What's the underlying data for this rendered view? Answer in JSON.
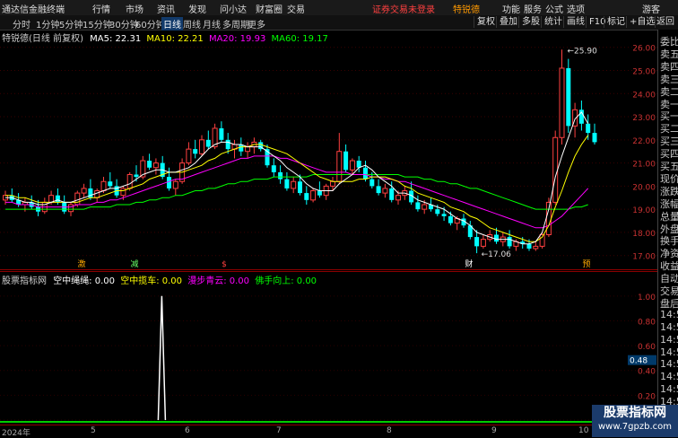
{
  "titlebar": {
    "app_name": "通达信金融终端",
    "menus": [
      "行情",
      "市场",
      "资讯",
      "发现",
      "问小达",
      "财富圈",
      "交易"
    ],
    "warning": "证券交易未登录",
    "account": "特锐德",
    "right_items": [
      "功能",
      "服务",
      "公式",
      "选项"
    ],
    "guest": "游客"
  },
  "periods": [
    "分时",
    "1分钟",
    "5分钟",
    "15分钟",
    "30分钟",
    "60分钟",
    "日线",
    "周线",
    "月线",
    "多周期",
    "更多"
  ],
  "active_period": "日线",
  "toolbar_right": [
    "复权",
    "叠加",
    "多股",
    "统计",
    "画线",
    "F10",
    "标记",
    "+自选",
    "返回"
  ],
  "ma": {
    "stock": "特锐德(日线 前复权)",
    "ma5": "MA5: 22.31",
    "ma10": "MA10: 22.21",
    "ma20": "MA20: 19.93",
    "ma60": "MA60: 19.17"
  },
  "colors": {
    "ma5": "#ffffff",
    "ma10": "#ffff00",
    "ma20": "#ff00ff",
    "ma60": "#00ff00",
    "up": "#ff4040",
    "down": "#00ffff"
  },
  "price_axis": [
    "26.00",
    "25.00",
    "24.00",
    "23.00",
    "22.00",
    "21.00",
    "20.00",
    "19.00",
    "18.00",
    "17.00"
  ],
  "annotations": {
    "high": "25.90",
    "low": "17.06"
  },
  "event_labels": [
    "激",
    "减",
    "$",
    "财",
    "预"
  ],
  "indicator": {
    "name": "股票指标网",
    "l1": "空中绳绳: 0.00",
    "l2": "空中揽车: 0.00",
    "l3": "漫步青云: 0.00",
    "l4": "佛手向上: 0.00",
    "axis": [
      "1.00",
      "0.80",
      "0.60",
      "0.40",
      "0.20",
      "0.00"
    ],
    "marker": "0.48"
  },
  "right_panel": [
    "委比",
    "卖五",
    "卖四",
    "卖三",
    "卖二",
    "卖一",
    "买一",
    "买二",
    "买三",
    "买四",
    "买五",
    "现价",
    "涨跌",
    "涨幅",
    "总量",
    "外盘",
    "换手",
    "净资",
    "收益",
    "自动",
    "交易",
    "盘后",
    "14:50",
    "14:50",
    "14:50",
    "14:50",
    "14:50",
    "14:50",
    "14:50",
    "14:50"
  ],
  "x_axis": [
    "2024年",
    "5",
    "6",
    "7",
    "8",
    "9",
    "10"
  ],
  "watermark": {
    "title": "股票指标网",
    "url": "www.7gpzb.com"
  },
  "chart_data": {
    "type": "candlestick",
    "ylim": [
      16.6,
      26.3
    ],
    "ohlc": [
      [
        19.4,
        19.8,
        19.2,
        19.6
      ],
      [
        19.6,
        19.9,
        19.3,
        19.4
      ],
      [
        19.4,
        19.7,
        19.1,
        19.2
      ],
      [
        19.2,
        19.5,
        18.9,
        19.3
      ],
      [
        19.3,
        19.6,
        19.0,
        19.1
      ],
      [
        19.1,
        19.4,
        18.7,
        18.9
      ],
      [
        18.9,
        19.5,
        18.8,
        19.3
      ],
      [
        19.3,
        19.8,
        19.2,
        19.6
      ],
      [
        19.6,
        19.9,
        19.2,
        19.3
      ],
      [
        19.3,
        19.6,
        18.8,
        18.9
      ],
      [
        18.9,
        19.3,
        18.7,
        19.2
      ],
      [
        19.2,
        19.8,
        19.1,
        19.7
      ],
      [
        19.7,
        20.1,
        19.5,
        19.9
      ],
      [
        19.9,
        20.3,
        19.4,
        19.5
      ],
      [
        19.5,
        19.9,
        19.3,
        19.8
      ],
      [
        19.8,
        20.4,
        19.7,
        20.2
      ],
      [
        20.2,
        20.6,
        19.9,
        20.0
      ],
      [
        20.0,
        20.3,
        19.5,
        19.6
      ],
      [
        19.6,
        20.0,
        19.4,
        19.9
      ],
      [
        19.9,
        20.6,
        19.8,
        20.5
      ],
      [
        20.5,
        20.9,
        20.2,
        20.4
      ],
      [
        20.4,
        21.3,
        20.3,
        21.1
      ],
      [
        21.1,
        21.4,
        20.7,
        20.8
      ],
      [
        20.8,
        21.2,
        20.5,
        21.0
      ],
      [
        21.0,
        21.3,
        20.3,
        20.4
      ],
      [
        20.4,
        20.8,
        19.8,
        19.9
      ],
      [
        19.9,
        20.3,
        19.6,
        20.2
      ],
      [
        20.2,
        21.2,
        20.1,
        21.0
      ],
      [
        21.0,
        21.9,
        20.9,
        21.6
      ],
      [
        21.6,
        22.0,
        21.2,
        21.4
      ],
      [
        21.4,
        22.2,
        21.3,
        22.0
      ],
      [
        22.0,
        22.4,
        21.6,
        21.7
      ],
      [
        21.7,
        22.7,
        21.6,
        22.5
      ],
      [
        22.5,
        22.8,
        21.9,
        22.0
      ],
      [
        22.0,
        22.3,
        21.4,
        21.6
      ],
      [
        21.6,
        22.0,
        21.2,
        21.8
      ],
      [
        21.8,
        22.1,
        21.3,
        21.5
      ],
      [
        21.5,
        21.9,
        21.2,
        21.7
      ],
      [
        21.7,
        22.1,
        21.4,
        21.9
      ],
      [
        21.9,
        22.0,
        21.5,
        21.6
      ],
      [
        21.6,
        21.8,
        20.8,
        20.9
      ],
      [
        20.9,
        21.2,
        20.4,
        20.6
      ],
      [
        20.6,
        20.9,
        20.1,
        20.3
      ],
      [
        20.3,
        20.6,
        19.8,
        19.9
      ],
      [
        19.9,
        20.4,
        19.7,
        20.2
      ],
      [
        20.2,
        20.5,
        19.6,
        19.7
      ],
      [
        19.7,
        20.0,
        19.2,
        19.4
      ],
      [
        19.4,
        19.9,
        19.3,
        19.8
      ],
      [
        19.8,
        20.2,
        19.5,
        19.6
      ],
      [
        19.6,
        20.1,
        19.4,
        20.0
      ],
      [
        20.0,
        20.4,
        19.8,
        20.2
      ],
      [
        20.2,
        22.3,
        20.1,
        21.5
      ],
      [
        21.5,
        21.8,
        20.6,
        20.7
      ],
      [
        20.7,
        21.2,
        20.5,
        21.1
      ],
      [
        21.1,
        21.3,
        20.6,
        20.8
      ],
      [
        20.8,
        21.1,
        20.2,
        20.3
      ],
      [
        20.3,
        20.6,
        19.9,
        20.0
      ],
      [
        20.0,
        20.3,
        19.6,
        19.7
      ],
      [
        19.7,
        20.1,
        19.5,
        19.9
      ],
      [
        19.9,
        20.2,
        19.3,
        19.4
      ],
      [
        19.4,
        19.8,
        19.2,
        19.6
      ],
      [
        19.6,
        20.0,
        19.4,
        19.8
      ],
      [
        19.8,
        20.2,
        19.2,
        19.3
      ],
      [
        19.3,
        19.6,
        18.9,
        19.0
      ],
      [
        19.0,
        19.4,
        18.8,
        19.2
      ],
      [
        19.2,
        19.5,
        18.9,
        19.0
      ],
      [
        19.0,
        19.2,
        18.7,
        18.8
      ],
      [
        18.8,
        19.1,
        18.5,
        18.7
      ],
      [
        18.7,
        18.9,
        18.3,
        18.4
      ],
      [
        18.4,
        18.7,
        18.1,
        18.6
      ],
      [
        18.6,
        18.8,
        18.2,
        18.3
      ],
      [
        18.3,
        18.5,
        17.7,
        17.8
      ],
      [
        17.8,
        18.1,
        17.1,
        17.4
      ],
      [
        17.4,
        17.9,
        17.3,
        17.7
      ],
      [
        17.7,
        18.1,
        17.6,
        17.9
      ],
      [
        17.9,
        18.2,
        17.5,
        17.6
      ],
      [
        17.6,
        18.0,
        17.4,
        17.8
      ],
      [
        17.8,
        18.1,
        17.3,
        17.4
      ],
      [
        17.4,
        17.7,
        17.2,
        17.6
      ],
      [
        17.6,
        17.8,
        17.3,
        17.5
      ],
      [
        17.5,
        17.7,
        17.2,
        17.3
      ],
      [
        17.3,
        17.6,
        17.2,
        17.4
      ],
      [
        17.4,
        18.0,
        17.3,
        17.9
      ],
      [
        17.9,
        19.5,
        17.8,
        19.3
      ],
      [
        19.3,
        22.4,
        19.2,
        22.1
      ],
      [
        22.1,
        25.9,
        21.8,
        25.1
      ],
      [
        25.1,
        25.5,
        22.3,
        22.6
      ],
      [
        22.6,
        23.6,
        22.1,
        23.3
      ],
      [
        23.3,
        23.7,
        22.4,
        22.7
      ],
      [
        22.7,
        23.1,
        22.0,
        22.3
      ],
      [
        22.3,
        22.7,
        21.8,
        21.9
      ]
    ],
    "ma5": [
      19.5,
      19.5,
      19.4,
      19.3,
      19.3,
      19.2,
      19.2,
      19.3,
      19.4,
      19.3,
      19.3,
      19.4,
      19.5,
      19.6,
      19.7,
      19.8,
      19.9,
      19.9,
      20.0,
      20.1,
      20.3,
      20.5,
      20.6,
      20.7,
      20.7,
      20.6,
      20.6,
      20.7,
      20.8,
      21.0,
      21.3,
      21.6,
      21.8,
      21.9,
      21.9,
      21.8,
      21.8,
      21.7,
      21.7,
      21.7,
      21.5,
      21.3,
      21.1,
      20.8,
      20.6,
      20.4,
      20.1,
      19.9,
      19.8,
      19.8,
      19.8,
      20.1,
      20.3,
      20.5,
      20.8,
      20.9,
      20.7,
      20.4,
      20.2,
      20.0,
      19.7,
      19.7,
      19.6,
      19.4,
      19.3,
      19.2,
      19.1,
      19.0,
      18.8,
      18.6,
      18.5,
      18.3,
      18.0,
      17.9,
      17.8,
      17.7,
      17.7,
      17.7,
      17.6,
      17.5,
      17.5,
      17.6,
      18.0,
      19.0,
      20.4,
      21.3,
      22.1,
      22.9,
      23.2,
      22.7
    ],
    "ma10": [
      19.6,
      19.6,
      19.5,
      19.5,
      19.4,
      19.3,
      19.3,
      19.3,
      19.3,
      19.3,
      19.3,
      19.3,
      19.4,
      19.5,
      19.5,
      19.6,
      19.7,
      19.8,
      19.8,
      19.9,
      20.0,
      20.1,
      20.3,
      20.4,
      20.5,
      20.6,
      20.6,
      20.6,
      20.7,
      20.8,
      20.9,
      21.1,
      21.2,
      21.4,
      21.5,
      21.6,
      21.7,
      21.7,
      21.8,
      21.8,
      21.7,
      21.6,
      21.5,
      21.4,
      21.2,
      21.0,
      20.8,
      20.6,
      20.4,
      20.3,
      20.2,
      20.2,
      20.2,
      20.2,
      20.3,
      20.3,
      20.4,
      20.4,
      20.4,
      20.3,
      20.2,
      20.0,
      19.9,
      19.7,
      19.6,
      19.5,
      19.4,
      19.3,
      19.1,
      19.0,
      18.9,
      18.7,
      18.6,
      18.4,
      18.2,
      18.1,
      18.0,
      17.9,
      17.8,
      17.7,
      17.6,
      17.6,
      17.8,
      18.3,
      19.1,
      19.8,
      20.6,
      21.3,
      21.8,
      22.2
    ],
    "ma20": [
      19.3,
      19.3,
      19.2,
      19.2,
      19.2,
      19.1,
      19.1,
      19.1,
      19.1,
      19.1,
      19.1,
      19.2,
      19.2,
      19.2,
      19.3,
      19.3,
      19.4,
      19.4,
      19.5,
      19.6,
      19.7,
      19.8,
      19.9,
      20.0,
      20.1,
      20.2,
      20.3,
      20.3,
      20.4,
      20.5,
      20.6,
      20.7,
      20.8,
      20.9,
      21.0,
      21.1,
      21.2,
      21.2,
      21.3,
      21.3,
      21.3,
      21.3,
      21.2,
      21.2,
      21.1,
      21.0,
      20.9,
      20.8,
      20.7,
      20.6,
      20.6,
      20.6,
      20.6,
      20.5,
      20.5,
      20.5,
      20.4,
      20.4,
      20.3,
      20.3,
      20.2,
      20.2,
      20.1,
      20.0,
      19.9,
      19.8,
      19.7,
      19.6,
      19.5,
      19.4,
      19.3,
      19.2,
      19.1,
      19.0,
      18.9,
      18.8,
      18.7,
      18.6,
      18.5,
      18.4,
      18.3,
      18.2,
      18.2,
      18.3,
      18.5,
      18.7,
      19.0,
      19.3,
      19.6,
      19.9
    ],
    "ma60": [
      19.0,
      19.0,
      19.0,
      19.0,
      19.0,
      19.0,
      19.0,
      19.0,
      19.0,
      19.0,
      19.0,
      19.0,
      19.0,
      19.1,
      19.1,
      19.1,
      19.1,
      19.2,
      19.2,
      19.2,
      19.3,
      19.3,
      19.4,
      19.4,
      19.5,
      19.5,
      19.6,
      19.6,
      19.7,
      19.8,
      19.8,
      19.9,
      19.9,
      20.0,
      20.1,
      20.1,
      20.2,
      20.2,
      20.3,
      20.3,
      20.3,
      20.4,
      20.4,
      20.4,
      20.4,
      20.4,
      20.4,
      20.5,
      20.5,
      20.5,
      20.5,
      20.5,
      20.5,
      20.5,
      20.5,
      20.5,
      20.5,
      20.5,
      20.5,
      20.5,
      20.5,
      20.4,
      20.4,
      20.4,
      20.3,
      20.3,
      20.2,
      20.2,
      20.1,
      20.1,
      20.0,
      19.9,
      19.9,
      19.8,
      19.7,
      19.6,
      19.5,
      19.4,
      19.3,
      19.2,
      19.1,
      19.0,
      19.0,
      19.0,
      19.0,
      19.0,
      19.0,
      19.1,
      19.1,
      19.2
    ],
    "indicator_spike_index": 28,
    "indicator_ylim": [
      0,
      1.1
    ]
  }
}
